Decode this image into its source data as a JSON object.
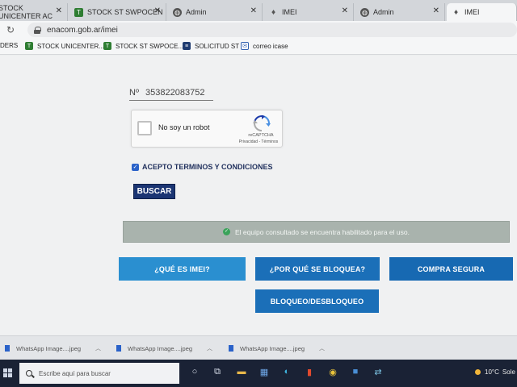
{
  "browser": {
    "tabs": [
      {
        "label": "STOCK UNICENTER AC",
        "icon": "",
        "active": false
      },
      {
        "label": "STOCK ST SWPOCEN",
        "icon": "green-t-icon",
        "active": false
      },
      {
        "label": "Admin",
        "icon": "globe-icon",
        "active": false
      },
      {
        "label": "IMEI",
        "icon": "enacom-icon",
        "active": false
      },
      {
        "label": "Admin",
        "icon": "globe-icon",
        "active": false
      },
      {
        "label": "IMEI",
        "icon": "enacom-icon",
        "active": true
      }
    ],
    "url": "enacom.gob.ar/imei",
    "bookmarks": [
      {
        "label": "DERS",
        "icon": ""
      },
      {
        "label": "STOCK UNICENTER...",
        "icon": "green-t-icon"
      },
      {
        "label": "STOCK ST SWPOCE...",
        "icon": "green-t-icon"
      },
      {
        "label": "SOLICITUD ST",
        "icon": "list-icon"
      },
      {
        "label": "correo icase",
        "icon": "mail-icon"
      }
    ]
  },
  "form": {
    "imei_prefix": "Nº",
    "imei_value": "353822083752",
    "recaptcha": {
      "label": "No soy un robot",
      "brand": "reCAPTCHA",
      "links": "Privacidad - Términos"
    },
    "terms_label": "ACEPTO TERMINOS Y CONDICIONES",
    "search_label": "BUSCAR"
  },
  "result": {
    "message": "El equipo consultado se encuentra habilitado para el uso.",
    "status_color": "#3aa35a"
  },
  "actions": {
    "what_is_imei": "¿QUÉ ES IMEI?",
    "why_blocked": "¿POR QUÉ SE BLOQUEA?",
    "safe_purchase": "COMPRA SEGURA",
    "block_unblock": "BLOQUEO/DESBLOQUEO"
  },
  "downloads": [
    {
      "label": "WhatsApp Image....jpeg"
    },
    {
      "label": "WhatsApp Image....jpeg"
    },
    {
      "label": "WhatsApp Image....jpeg"
    }
  ],
  "taskbar": {
    "search_placeholder": "Escribe aquí para buscar",
    "weather": "10°C",
    "weather_suffix": "Sole"
  },
  "colors": {
    "accent_dark": "#1b3573",
    "accent_blue": "#2a8fd0",
    "alert_bg": "#a9b3ad"
  }
}
